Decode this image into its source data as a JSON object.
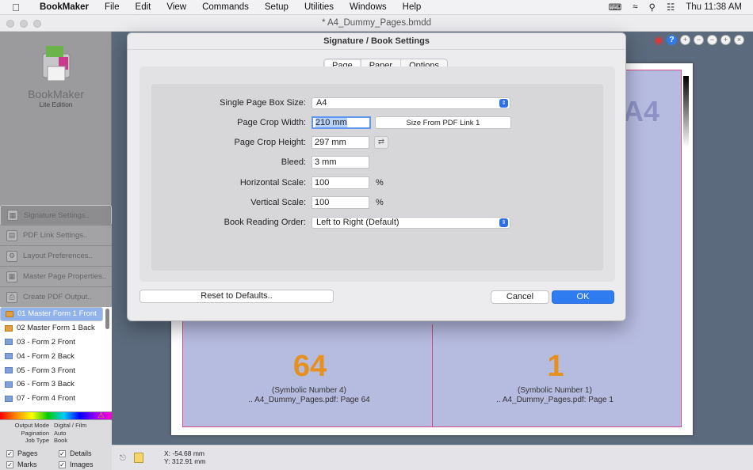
{
  "menubar": {
    "app": "BookMaker",
    "items": [
      "File",
      "Edit",
      "View",
      "Commands",
      "Setup",
      "Utilities",
      "Windows",
      "Help"
    ],
    "clock": "Thu 11:38 AM"
  },
  "window": {
    "title": "* A4_Dummy_Pages.bmdd"
  },
  "sidebar": {
    "logo_title": "BookMaker",
    "logo_sub": "Lite Edition",
    "nav": [
      "Signature Settings..",
      "PDF Link Settings..",
      "Layout Preferences..",
      "Master Page Properties..",
      "Create PDF Output.."
    ],
    "pages": [
      "01 Master Form 1 Front",
      "02 Master Form 1 Back",
      "03 - Form 2 Front",
      "04 - Form 2 Back",
      "05 - Form 3 Front",
      "06 - Form 3 Back",
      "07 - Form 4 Front"
    ],
    "info": [
      {
        "k": "Output Mode",
        "v": "Digital / Film"
      },
      {
        "k": "Pagination",
        "v": "Auto"
      },
      {
        "k": "Job Type",
        "v": "Book"
      }
    ],
    "checks": [
      "Pages",
      "Details",
      "Marks",
      "Images"
    ]
  },
  "canvas": {
    "a4_label": "A4",
    "left_num": "64",
    "left_sym": "(Symbolic Number 4)",
    "left_src": ".. A4_Dummy_Pages.pdf: Page 64",
    "right_num": "1",
    "right_sym": "(Symbolic Number 1)",
    "right_src": ".. A4_Dummy_Pages.pdf: Page 1"
  },
  "status": {
    "x": "X: -54.68 mm",
    "y": "Y: 312.91 mm"
  },
  "dialog": {
    "title": "Signature / Book Settings",
    "tabs": [
      "Page",
      "Paper",
      "Options"
    ],
    "page_box_label": "Single Page Box Size:",
    "page_box_value": "A4",
    "crop_w_label": "Page Crop Width:",
    "crop_w_value": "210 mm",
    "size_from_pdf": "Size From PDF Link 1",
    "crop_h_label": "Page Crop Height:",
    "crop_h_value": "297 mm",
    "bleed_label": "Bleed:",
    "bleed_value": "3 mm",
    "hscale_label": "Horizontal Scale:",
    "hscale_value": "100",
    "vscale_label": "Vertical Scale:",
    "vscale_value": "100",
    "percent": "%",
    "order_label": "Book Reading Order:",
    "order_value": "Left to Right (Default)",
    "reset": "Reset to Defaults..",
    "cancel": "Cancel",
    "ok": "OK"
  }
}
